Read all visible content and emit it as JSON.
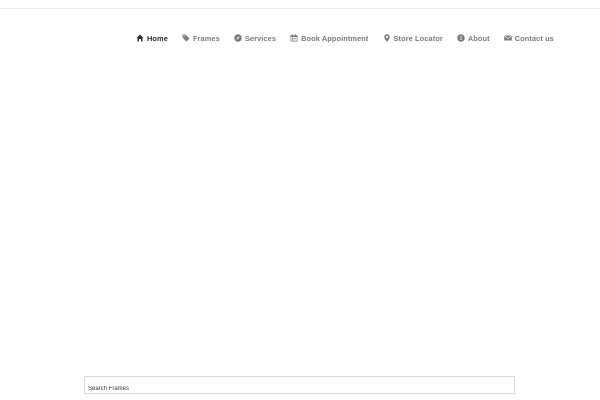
{
  "nav": {
    "items": [
      {
        "label": "Home",
        "icon": "home-icon",
        "active": true
      },
      {
        "label": "Frames",
        "icon": "tag-icon",
        "active": false
      },
      {
        "label": "Services",
        "icon": "compass-icon",
        "active": false
      },
      {
        "label": "Book Appointment",
        "icon": "calendar-icon",
        "active": false
      },
      {
        "label": "Store Locator",
        "icon": "map-marker-icon",
        "active": false
      },
      {
        "label": "About",
        "icon": "info-icon",
        "active": false
      },
      {
        "label": "Contact us",
        "icon": "envelope-icon",
        "active": false
      }
    ]
  },
  "search": {
    "placeholder": "Search Frames",
    "value": ""
  },
  "colors": {
    "nav_text": "#7b7b7b",
    "nav_active": "#2a2a2a",
    "border": "#dcdcdc"
  }
}
